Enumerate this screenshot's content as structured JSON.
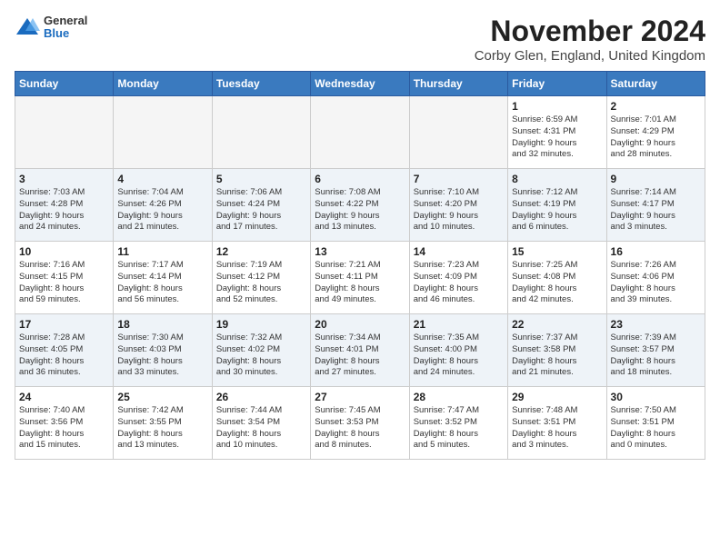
{
  "header": {
    "logo_general": "General",
    "logo_blue": "Blue",
    "title": "November 2024",
    "subtitle": "Corby Glen, England, United Kingdom"
  },
  "days_of_week": [
    "Sunday",
    "Monday",
    "Tuesday",
    "Wednesday",
    "Thursday",
    "Friday",
    "Saturday"
  ],
  "weeks": [
    [
      {
        "num": "",
        "info": "",
        "empty": true
      },
      {
        "num": "",
        "info": "",
        "empty": true
      },
      {
        "num": "",
        "info": "",
        "empty": true
      },
      {
        "num": "",
        "info": "",
        "empty": true
      },
      {
        "num": "",
        "info": "",
        "empty": true
      },
      {
        "num": "1",
        "info": "Sunrise: 6:59 AM\nSunset: 4:31 PM\nDaylight: 9 hours\nand 32 minutes.",
        "empty": false
      },
      {
        "num": "2",
        "info": "Sunrise: 7:01 AM\nSunset: 4:29 PM\nDaylight: 9 hours\nand 28 minutes.",
        "empty": false
      }
    ],
    [
      {
        "num": "3",
        "info": "Sunrise: 7:03 AM\nSunset: 4:28 PM\nDaylight: 9 hours\nand 24 minutes.",
        "empty": false
      },
      {
        "num": "4",
        "info": "Sunrise: 7:04 AM\nSunset: 4:26 PM\nDaylight: 9 hours\nand 21 minutes.",
        "empty": false
      },
      {
        "num": "5",
        "info": "Sunrise: 7:06 AM\nSunset: 4:24 PM\nDaylight: 9 hours\nand 17 minutes.",
        "empty": false
      },
      {
        "num": "6",
        "info": "Sunrise: 7:08 AM\nSunset: 4:22 PM\nDaylight: 9 hours\nand 13 minutes.",
        "empty": false
      },
      {
        "num": "7",
        "info": "Sunrise: 7:10 AM\nSunset: 4:20 PM\nDaylight: 9 hours\nand 10 minutes.",
        "empty": false
      },
      {
        "num": "8",
        "info": "Sunrise: 7:12 AM\nSunset: 4:19 PM\nDaylight: 9 hours\nand 6 minutes.",
        "empty": false
      },
      {
        "num": "9",
        "info": "Sunrise: 7:14 AM\nSunset: 4:17 PM\nDaylight: 9 hours\nand 3 minutes.",
        "empty": false
      }
    ],
    [
      {
        "num": "10",
        "info": "Sunrise: 7:16 AM\nSunset: 4:15 PM\nDaylight: 8 hours\nand 59 minutes.",
        "empty": false
      },
      {
        "num": "11",
        "info": "Sunrise: 7:17 AM\nSunset: 4:14 PM\nDaylight: 8 hours\nand 56 minutes.",
        "empty": false
      },
      {
        "num": "12",
        "info": "Sunrise: 7:19 AM\nSunset: 4:12 PM\nDaylight: 8 hours\nand 52 minutes.",
        "empty": false
      },
      {
        "num": "13",
        "info": "Sunrise: 7:21 AM\nSunset: 4:11 PM\nDaylight: 8 hours\nand 49 minutes.",
        "empty": false
      },
      {
        "num": "14",
        "info": "Sunrise: 7:23 AM\nSunset: 4:09 PM\nDaylight: 8 hours\nand 46 minutes.",
        "empty": false
      },
      {
        "num": "15",
        "info": "Sunrise: 7:25 AM\nSunset: 4:08 PM\nDaylight: 8 hours\nand 42 minutes.",
        "empty": false
      },
      {
        "num": "16",
        "info": "Sunrise: 7:26 AM\nSunset: 4:06 PM\nDaylight: 8 hours\nand 39 minutes.",
        "empty": false
      }
    ],
    [
      {
        "num": "17",
        "info": "Sunrise: 7:28 AM\nSunset: 4:05 PM\nDaylight: 8 hours\nand 36 minutes.",
        "empty": false
      },
      {
        "num": "18",
        "info": "Sunrise: 7:30 AM\nSunset: 4:03 PM\nDaylight: 8 hours\nand 33 minutes.",
        "empty": false
      },
      {
        "num": "19",
        "info": "Sunrise: 7:32 AM\nSunset: 4:02 PM\nDaylight: 8 hours\nand 30 minutes.",
        "empty": false
      },
      {
        "num": "20",
        "info": "Sunrise: 7:34 AM\nSunset: 4:01 PM\nDaylight: 8 hours\nand 27 minutes.",
        "empty": false
      },
      {
        "num": "21",
        "info": "Sunrise: 7:35 AM\nSunset: 4:00 PM\nDaylight: 8 hours\nand 24 minutes.",
        "empty": false
      },
      {
        "num": "22",
        "info": "Sunrise: 7:37 AM\nSunset: 3:58 PM\nDaylight: 8 hours\nand 21 minutes.",
        "empty": false
      },
      {
        "num": "23",
        "info": "Sunrise: 7:39 AM\nSunset: 3:57 PM\nDaylight: 8 hours\nand 18 minutes.",
        "empty": false
      }
    ],
    [
      {
        "num": "24",
        "info": "Sunrise: 7:40 AM\nSunset: 3:56 PM\nDaylight: 8 hours\nand 15 minutes.",
        "empty": false
      },
      {
        "num": "25",
        "info": "Sunrise: 7:42 AM\nSunset: 3:55 PM\nDaylight: 8 hours\nand 13 minutes.",
        "empty": false
      },
      {
        "num": "26",
        "info": "Sunrise: 7:44 AM\nSunset: 3:54 PM\nDaylight: 8 hours\nand 10 minutes.",
        "empty": false
      },
      {
        "num": "27",
        "info": "Sunrise: 7:45 AM\nSunset: 3:53 PM\nDaylight: 8 hours\nand 8 minutes.",
        "empty": false
      },
      {
        "num": "28",
        "info": "Sunrise: 7:47 AM\nSunset: 3:52 PM\nDaylight: 8 hours\nand 5 minutes.",
        "empty": false
      },
      {
        "num": "29",
        "info": "Sunrise: 7:48 AM\nSunset: 3:51 PM\nDaylight: 8 hours\nand 3 minutes.",
        "empty": false
      },
      {
        "num": "30",
        "info": "Sunrise: 7:50 AM\nSunset: 3:51 PM\nDaylight: 8 hours\nand 0 minutes.",
        "empty": false
      }
    ]
  ]
}
